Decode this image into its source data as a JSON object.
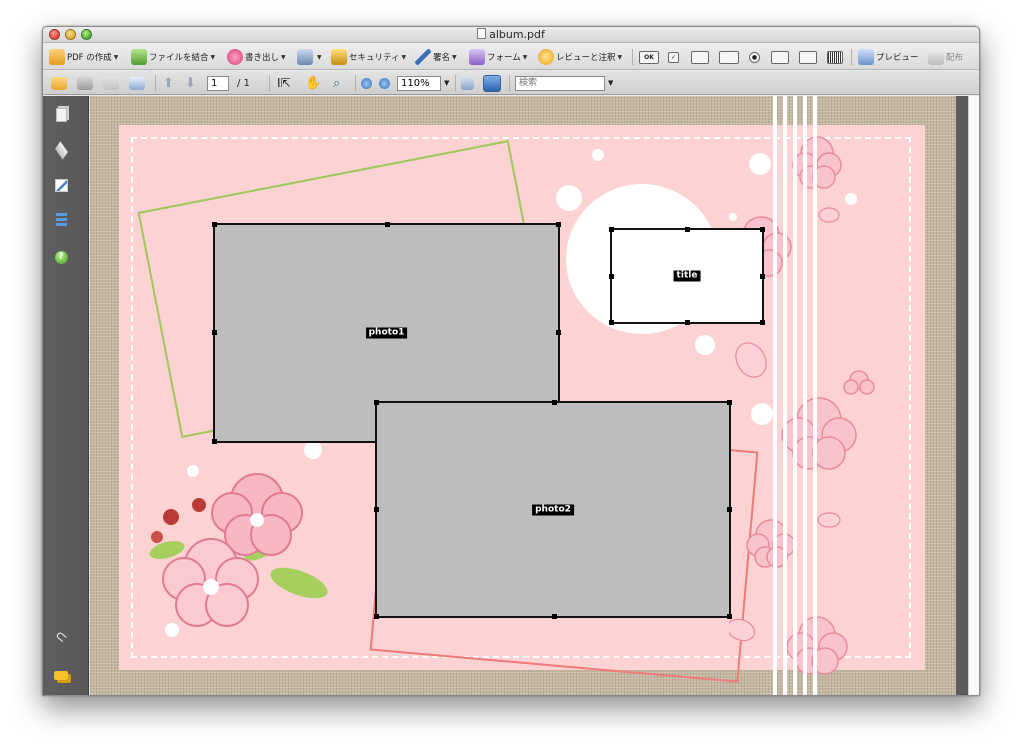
{
  "window": {
    "title": "album.pdf"
  },
  "toolbar1": {
    "create_pdf": "PDF の作成",
    "combine": "ファイルを結合",
    "export": "書き出し",
    "security": "セキュリティ",
    "sign": "署名",
    "forms": "フォーム",
    "review": "レビューと注釈",
    "ok_label": "OK",
    "preview": "プレビュー",
    "distribute": "配布"
  },
  "toolbar2": {
    "page_current": "1",
    "page_total": "/ 1",
    "zoom": "110%",
    "search_placeholder": "検索"
  },
  "document": {
    "photo1_label": "photo1",
    "photo2_label": "photo2",
    "title_label": "title"
  },
  "colors": {
    "page_pink": "#fdd2d2",
    "burlap": "#c4b7a2",
    "frame_green": "#9cc85a",
    "frame_red": "#f07a7a",
    "photo_gray": "#bdbdbd"
  }
}
